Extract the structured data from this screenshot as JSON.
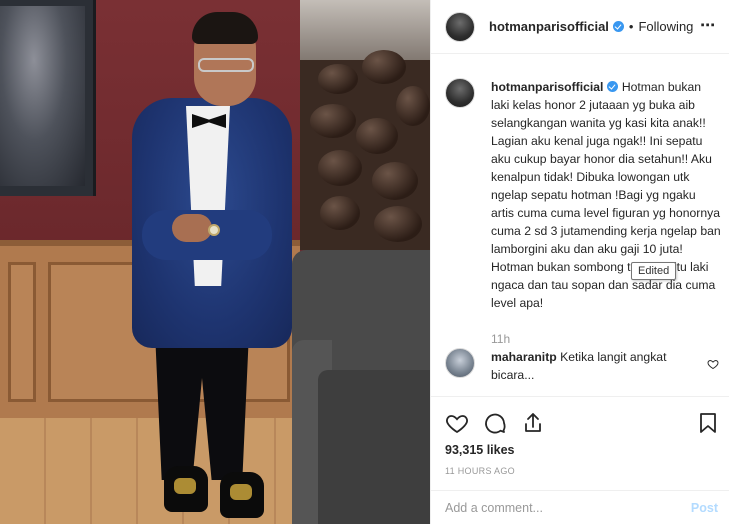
{
  "header": {
    "username": "hotmanparisofficial",
    "separator": "•",
    "follow_status": "Following",
    "more_icon": "ellipsis-icon"
  },
  "caption": {
    "username": "hotmanparisofficial",
    "text": "Hotman bukan laki kelas honor 2 jutaaan yg buka aib selangkangan wanita yg kasi kita anak!! Lagian aku kenal juga ngak!! Ini sepatu aku cukup bayar honor dia setahun!! Aku kenalpun tidak! Dibuka lowongan utk ngelap sepatu hotman !Bagi yg ngaku artis cuma cuma level figuran yg honornya cuma 2 sd 3 jutamending kerja ngelap ban lamborgini aku dan aku gaji 10 juta! Hotman bukan sombong tapi biar itu laki ngaca dan tau sopan dan sadar dia cuma level apa!",
    "time": "11h"
  },
  "tooltip": {
    "text": "Edited"
  },
  "comment": {
    "username": "maharanitp",
    "text": "Ketika langit angkat bicara..."
  },
  "actions": {
    "likes": "93,315 likes",
    "time_ago": "11 HOURS AGO"
  },
  "add_comment": {
    "placeholder": "Add a comment...",
    "post_label": "Post"
  },
  "colors": {
    "verified": "#3897f0",
    "post_disabled": "#b3dbff",
    "muted": "#999999"
  }
}
